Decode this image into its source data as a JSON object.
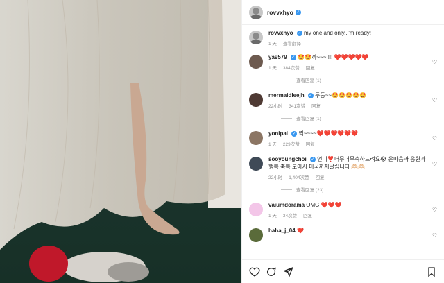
{
  "post": {
    "username": "rovvxhyo",
    "caption_user": "rovvxhyo",
    "caption_text": "my one and only..i'm ready!",
    "caption_time": "1 天",
    "caption_translate": "查看翻译"
  },
  "comments": [
    {
      "user": "ya9579",
      "text": "🤩🤩까~~~!!!! ❤️❤️❤️❤️❤️",
      "time": "1 天",
      "likes": "384次赞",
      "reply": "回复",
      "replies": "查看回复 (1)",
      "avatar_color": "#6d5a4f"
    },
    {
      "user": "mermaidleejh",
      "text": "두둥~~🤩🤩🤩🤩🤩",
      "time": "22小时",
      "likes": "341次赞",
      "reply": "回复",
      "replies": "查看回复 (1)",
      "avatar_color": "#4f3a34"
    },
    {
      "user": "yonipai",
      "text": "짝~~~~❤️❤️❤️❤️❤️❤️",
      "time": "1 天",
      "likes": "229次赞",
      "reply": "回复",
      "replies": "",
      "avatar_color": "#8c7664"
    },
    {
      "user": "sooyoungchoi",
      "text": "언니❣️너무너무축하드려요😭 온마음과 응원과 행복 축복 모아서 미국까지날립니다 🫶🏻🫶🏻",
      "time": "22小时",
      "likes": "1,404次赞",
      "reply": "回复",
      "replies": "查看回复 (23)",
      "avatar_color": "#3f4a57"
    },
    {
      "user": "vaiumdorama",
      "text": "OMG ❤️❤️❤️",
      "time": "1 天",
      "likes": "34次赞",
      "reply": "回复",
      "replies": "",
      "avatar_color": "#f3c6e8"
    },
    {
      "user": "haha_j_04",
      "text": "❤️",
      "time": "",
      "likes": "",
      "reply": "",
      "replies": "",
      "avatar_color": "#5a6b3a"
    }
  ],
  "icons": {
    "like": "heart-icon",
    "comment": "comment-icon",
    "share": "share-icon",
    "save": "bookmark-icon"
  },
  "colors": {
    "verified": "#3897f0",
    "heart_red": "#ed4956",
    "meta_gray": "#8e8e8e"
  }
}
